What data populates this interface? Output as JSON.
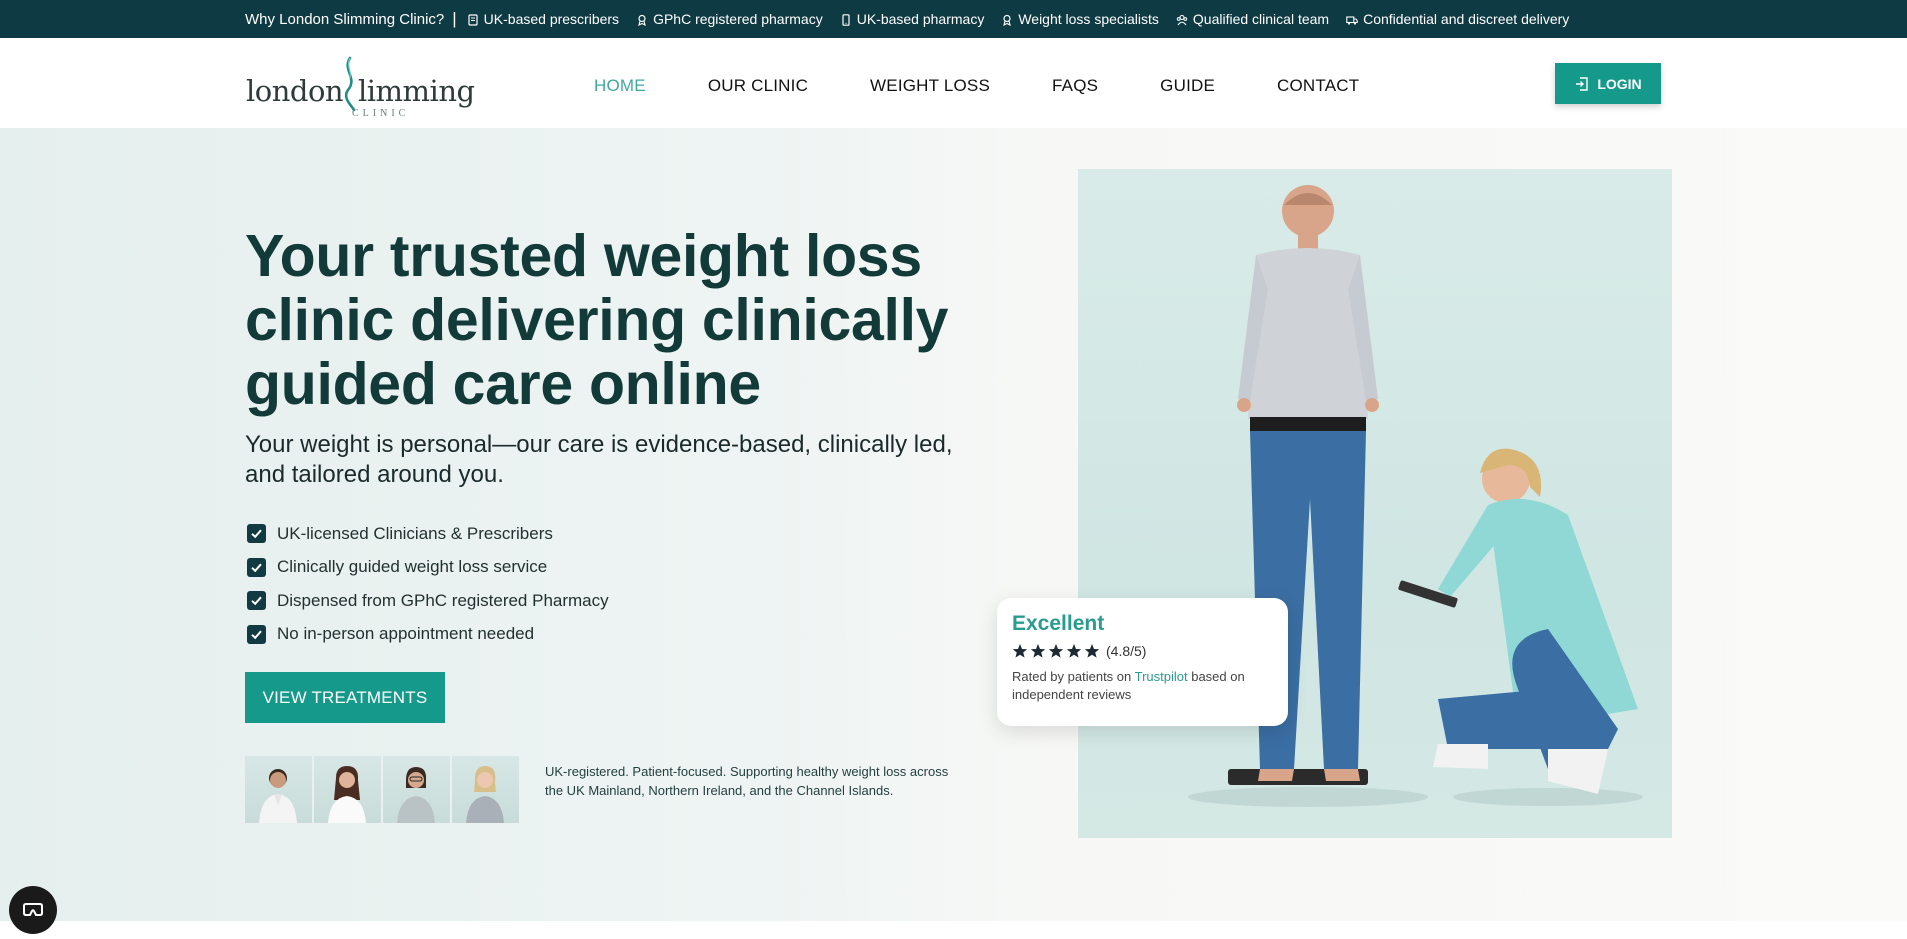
{
  "topbar": {
    "why": "Why London Slimming Clinic?",
    "separator": "|",
    "items": [
      {
        "icon": "document-icon",
        "label": "UK-based prescribers"
      },
      {
        "icon": "badge-icon",
        "label": "GPhC registered pharmacy"
      },
      {
        "icon": "phone-icon",
        "label": "UK-based pharmacy"
      },
      {
        "icon": "badge-icon",
        "label": "Weight loss specialists"
      },
      {
        "icon": "team-icon",
        "label": "Qualified clinical team"
      },
      {
        "icon": "truck-icon",
        "label": "Confidential and discreet delivery"
      }
    ]
  },
  "header": {
    "logo": {
      "word1": "london",
      "word2": "limming",
      "sub": "CLINIC"
    },
    "nav": [
      {
        "label": "HOME",
        "active": true
      },
      {
        "label": "OUR CLINIC",
        "active": false
      },
      {
        "label": "WEIGHT LOSS",
        "active": false
      },
      {
        "label": "FAQS",
        "active": false
      },
      {
        "label": "GUIDE",
        "active": false
      },
      {
        "label": "CONTACT",
        "active": false
      }
    ],
    "login_label": "LOGIN"
  },
  "hero": {
    "headline": "Your trusted weight loss clinic delivering clinically guided care online",
    "subhead": "Your weight is personal—our care is evidence-based, clinically led, and tailored around you.",
    "checklist": [
      "UK-licensed Clinicians & Prescribers",
      "Clinically guided weight loss service",
      "Dispensed from GPhC registered Pharmacy",
      "No in-person appointment needed"
    ],
    "cta_label": "VIEW TREATMENTS",
    "team_note": "UK-registered. Patient-focused. Supporting healthy weight loss across the UK Mainland, Northern Ireland, and the Channel Islands."
  },
  "review": {
    "title": "Excellent",
    "stars": 5,
    "score": "(4.8/5)",
    "text_before": "Rated by patients on ",
    "brand": "Trustpilot",
    "text_after": " based on independent reviews"
  },
  "colors": {
    "topbar_bg": "#0e3a44",
    "accent": "#15998a",
    "nav_active": "#3fa9a0",
    "headline": "#123a38",
    "checkbox": "#123a42"
  }
}
